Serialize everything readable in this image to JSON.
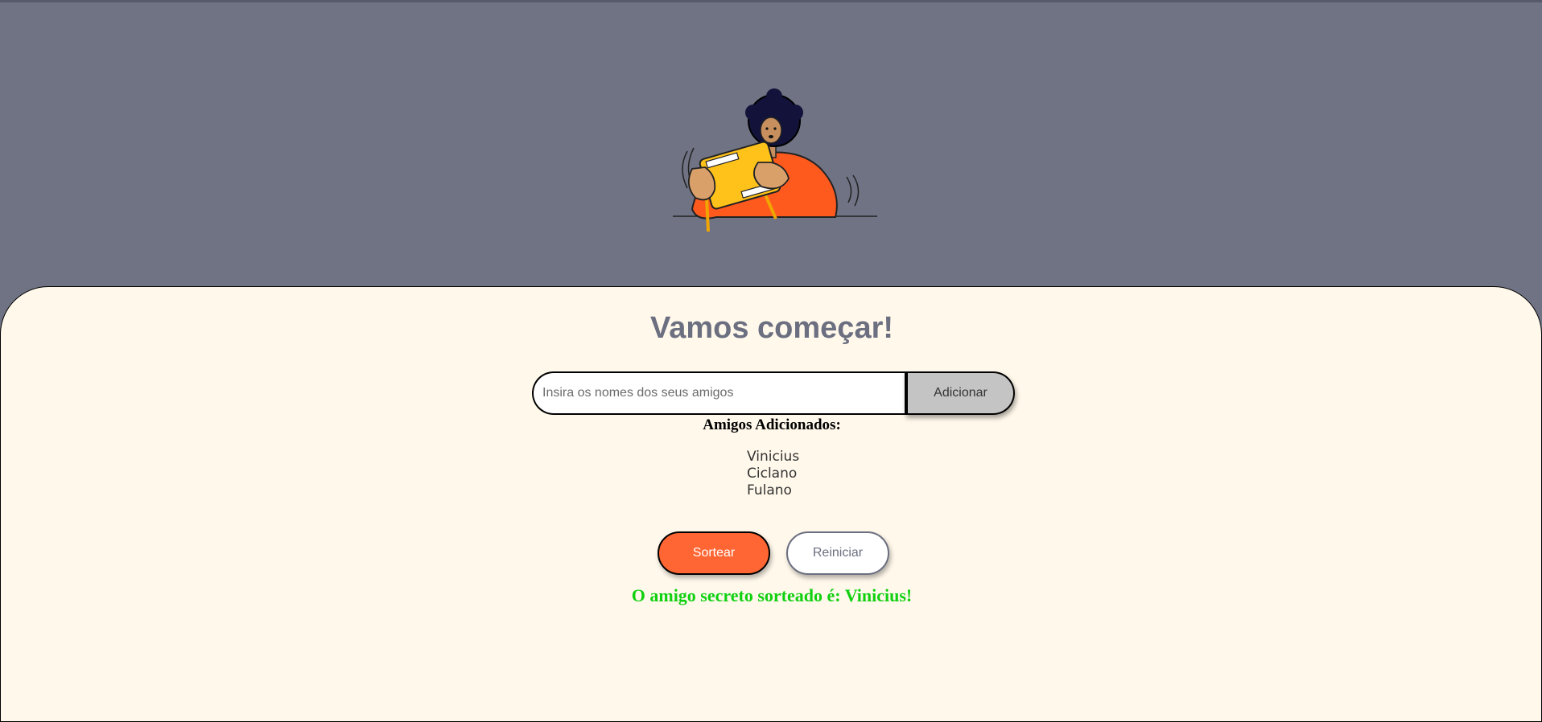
{
  "colors": {
    "page_background": "#6f7384",
    "panel_background": "#fff8eb",
    "title": "#6b6f80",
    "primary_button": "#ff6633",
    "add_button": "#c4c4c4",
    "result_text": "#10d010"
  },
  "hero": {
    "illustration": "person-playing-handheld-game"
  },
  "main": {
    "title": "Vamos começar!",
    "input": {
      "placeholder": "Insira os nomes dos seus amigos",
      "value": ""
    },
    "add_label": "Adicionar",
    "list_title": "Amigos Adicionados:",
    "friends": [
      "Vinicius",
      "Ciclano",
      "Fulano"
    ],
    "draw_label": "Sortear",
    "reset_label": "Reiniciar",
    "result": "O amigo secreto sorteado é: Vinicius!"
  }
}
